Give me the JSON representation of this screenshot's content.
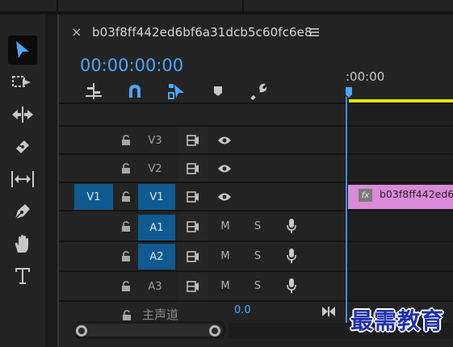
{
  "sequence": {
    "title": "b03f8ff442ed6bf6a31dcb5c60fc6e8",
    "timecode": "00:00:00:00",
    "ruler_time": ":00:00"
  },
  "tools": [
    {
      "name": "selection-tool",
      "icon": "arrow-icon",
      "active": true
    },
    {
      "name": "track-select-tool",
      "icon": "track-select-icon",
      "active": false
    },
    {
      "name": "ripple-edit-tool",
      "icon": "ripple-edit-icon",
      "active": false
    },
    {
      "name": "razor-tool",
      "icon": "razor-icon",
      "active": false
    },
    {
      "name": "slip-tool",
      "icon": "slip-icon",
      "active": false
    },
    {
      "name": "pen-tool",
      "icon": "pen-icon",
      "active": false
    },
    {
      "name": "hand-tool",
      "icon": "hand-icon",
      "active": false
    },
    {
      "name": "type-tool",
      "icon": "type-icon",
      "active": false
    }
  ],
  "tracks": {
    "video": [
      {
        "label": "V3",
        "source": "",
        "targeted": false
      },
      {
        "label": "V2",
        "source": "",
        "targeted": false
      },
      {
        "label": "V1",
        "source": "V1",
        "targeted": true
      }
    ],
    "audio": [
      {
        "label": "A1",
        "source": "",
        "targeted": true,
        "mute": "M",
        "solo": "S"
      },
      {
        "label": "A2",
        "source": "",
        "targeted": true,
        "mute": "M",
        "solo": "S"
      },
      {
        "label": "A3",
        "source": "",
        "targeted": false,
        "mute": "M",
        "solo": "S"
      }
    ]
  },
  "clip": {
    "fx_badge": "fx",
    "name": "b03f8ff442ed6",
    "color": "#d98ad8"
  },
  "master": {
    "label": "主声道",
    "value": "0.0"
  },
  "watermark": "最需教育",
  "colors": {
    "accent": "#4aa8ff",
    "target_blue": "#0f5a91",
    "work_area": "#e6e600",
    "playhead": "#3d8fe0"
  }
}
